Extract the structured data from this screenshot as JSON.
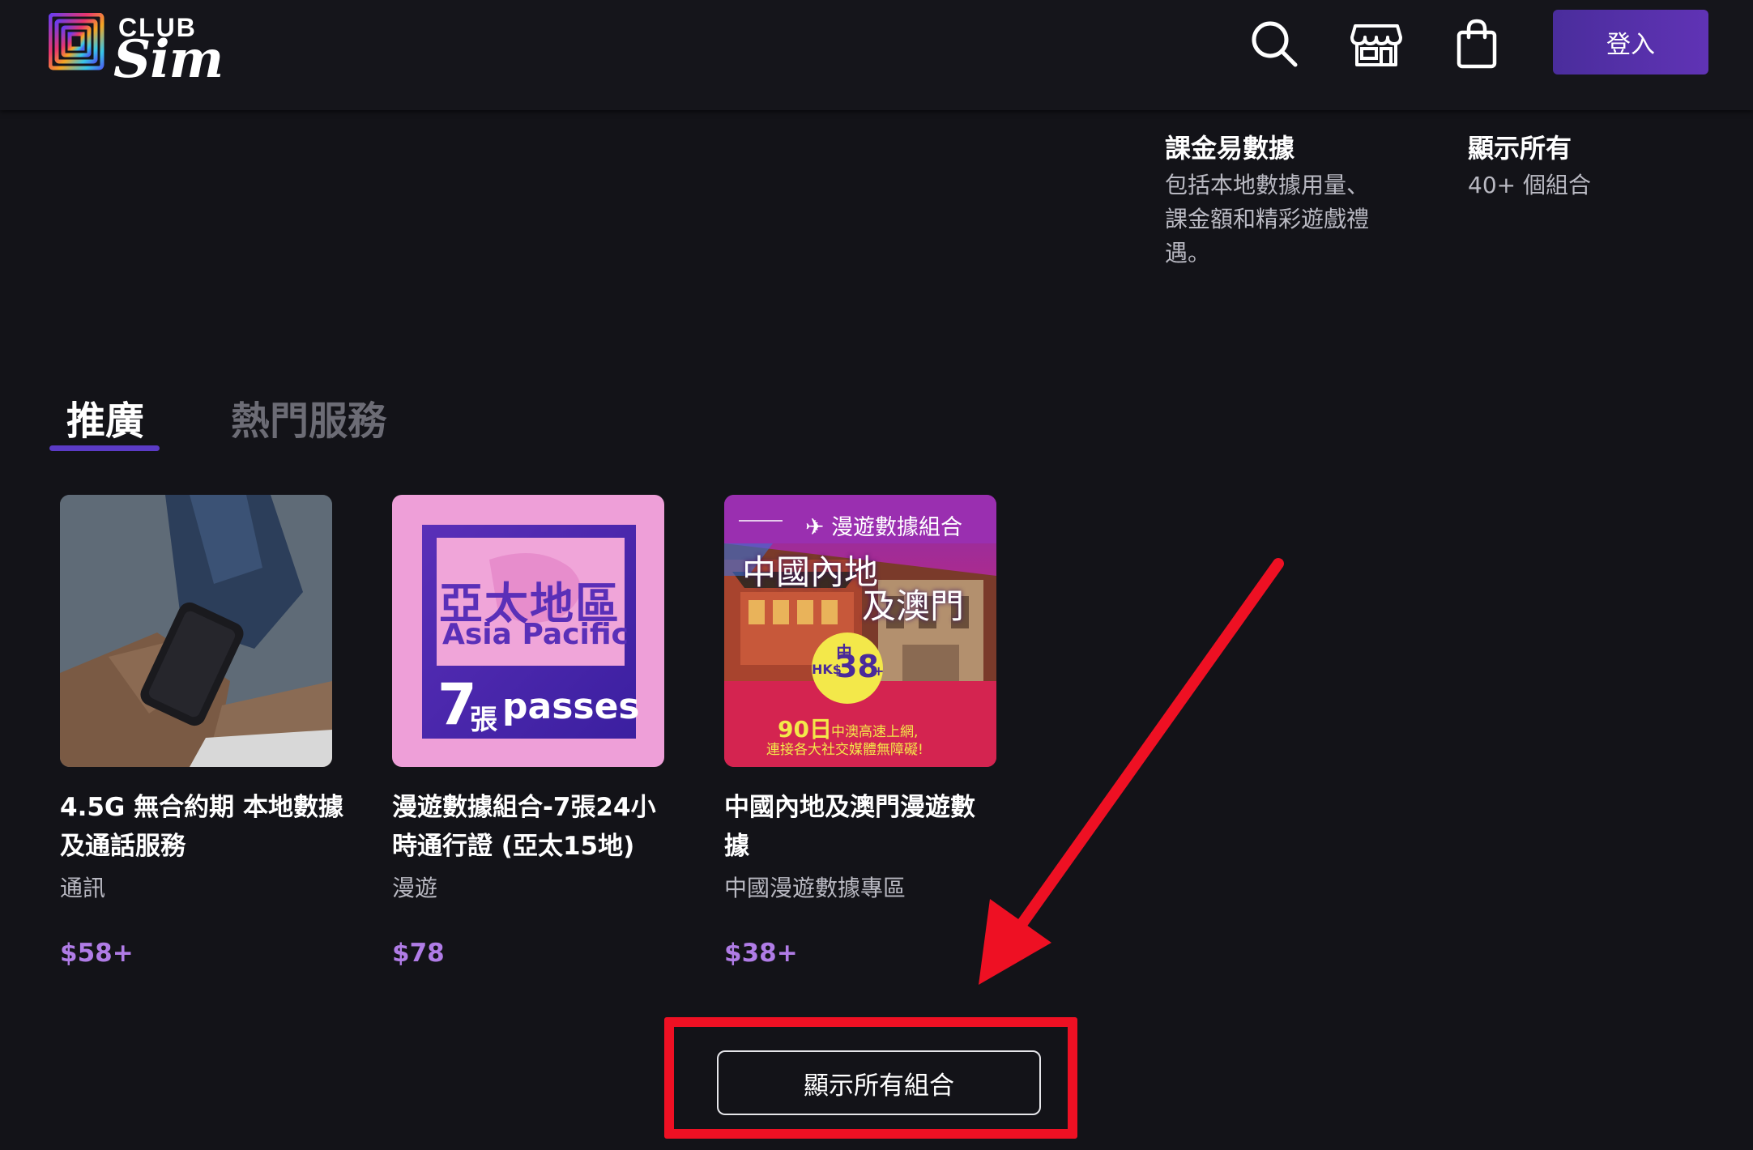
{
  "header": {
    "logo_club": "CLUB",
    "logo_sim": "Sim",
    "icons": [
      "search-icon",
      "store-icon",
      "shopping-bag-icon"
    ],
    "login_label": "登入"
  },
  "categories": [
    {
      "title": "課金易數據",
      "desc_lines": [
        "包括本地數據用量、",
        "課金額和精彩遊戲禮",
        "遇。"
      ]
    },
    {
      "title": "顯示所有",
      "desc_lines": [
        "40+ 個組合"
      ]
    }
  ],
  "tabs": [
    {
      "label": "推廣",
      "active": true
    },
    {
      "label": "熱門服務",
      "active": false
    }
  ],
  "cards": [
    {
      "title_lines": [
        "4.5G 無合約期 本地數據",
        "及通話服務"
      ],
      "category": "通訊",
      "price": "$58+"
    },
    {
      "title_lines": [
        "漫遊數據組合-7張24小",
        "時通行證 (亞太15地)"
      ],
      "category": "漫遊",
      "price": "$78",
      "image_text": {
        "zh": "亞太地區",
        "en": "Asia Pacific",
        "num": "7",
        "unit": "張",
        "passes": "passes"
      }
    },
    {
      "title_lines": [
        "中國內地及澳門漫遊數",
        "據"
      ],
      "category": "中國漫遊數據專區",
      "price": "$38+",
      "image_text": {
        "banner": "漫遊數據組合",
        "line1": "中國內地",
        "line2": "及澳門",
        "from": "由",
        "hk": "HK$",
        "price": "38",
        "plus": "+",
        "days": "90日",
        "days_desc": "中澳高速上網,",
        "footer": "連接各大社交媒體無障礙!"
      }
    }
  ],
  "show_all_label": "顯示所有組合",
  "colors": {
    "background": "#131318",
    "accent": "#5b3bc6",
    "price": "#b07ce6",
    "annotation": "#ee1023"
  }
}
